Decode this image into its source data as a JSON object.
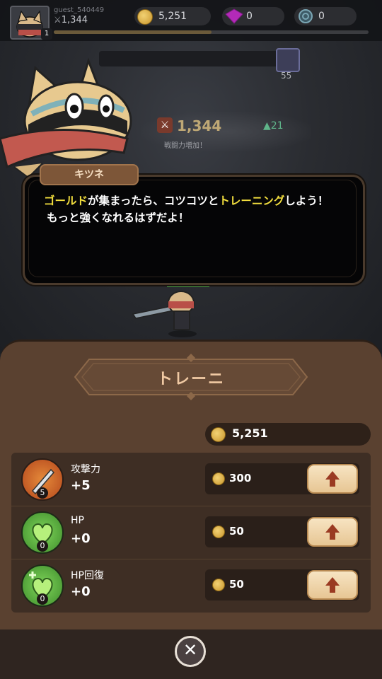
{
  "hud": {
    "username": "guest_540449",
    "power": "1,344",
    "level": "1",
    "xp_fraction": 0.5,
    "gold": "5,251",
    "gems": "0",
    "keys": "0"
  },
  "enemy": {
    "level": "55"
  },
  "power_panel": {
    "value": "1,344",
    "delta": "▲21",
    "caption": "戦闘力増加！"
  },
  "dialog": {
    "speaker": "キツネ",
    "segments": [
      {
        "text": "ゴールド",
        "hl": true
      },
      {
        "text": "が集まったら、コツコツと",
        "hl": false
      },
      {
        "text": "トレーニング",
        "hl": true
      },
      {
        "text": "しよう！",
        "hl": false
      }
    ],
    "line2": "もっと強くなれるはずだよ！"
  },
  "training": {
    "title": "トレーニ",
    "gold": "5,251",
    "rows": [
      {
        "name": "攻撃力",
        "value": "+5",
        "level": "5",
        "cost": "300",
        "icon": "attack-icon",
        "color": "#d56a2a"
      },
      {
        "name": "HP",
        "value": "+0",
        "level": "0",
        "cost": "50",
        "icon": "heart-icon",
        "color": "#57b43b"
      },
      {
        "name": "HP回復",
        "value": "+0",
        "level": "0",
        "cost": "50",
        "icon": "heart-plus-icon",
        "color": "#57b43b"
      }
    ]
  },
  "colors": {
    "highlight": "#f3df3e",
    "panel": "#5a4130",
    "button": "#f1d9b0"
  }
}
